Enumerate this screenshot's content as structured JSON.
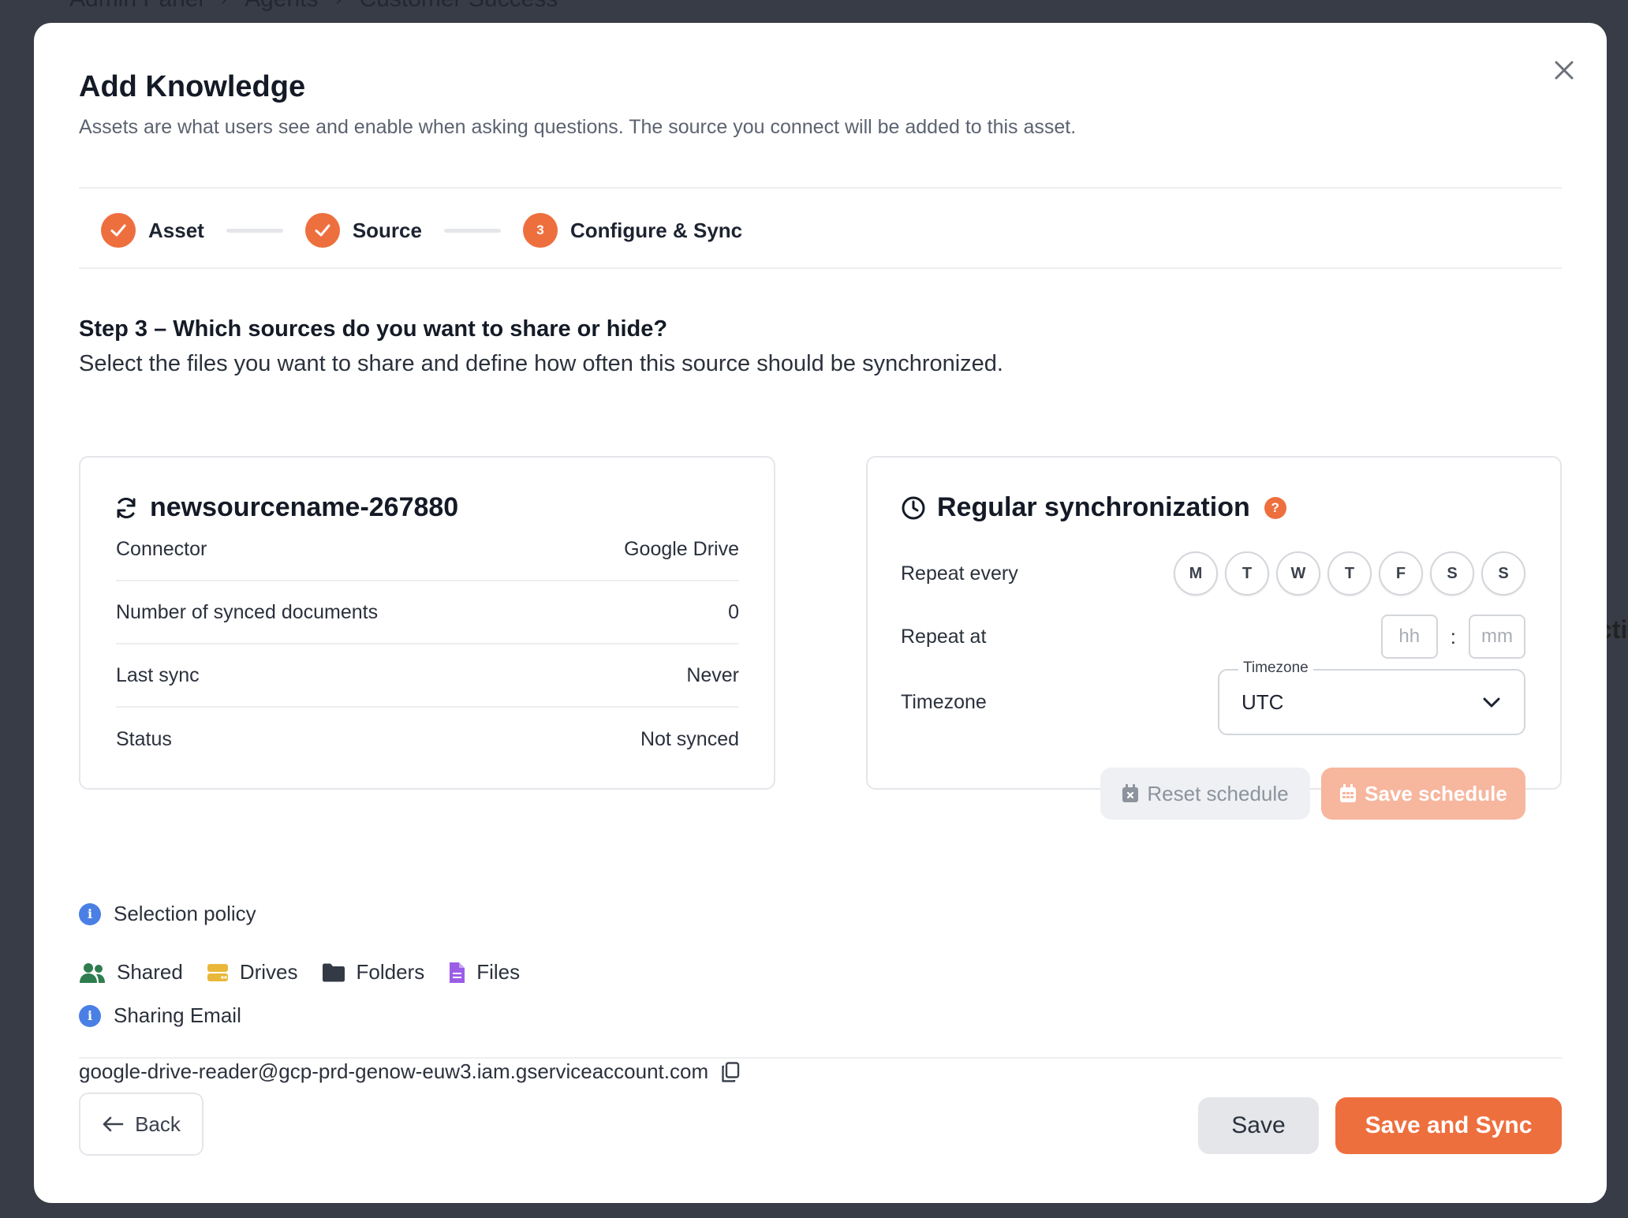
{
  "background": {
    "breadcrumb": [
      "Admin Panel",
      "Agents",
      "Customer Success"
    ],
    "edge_text": "cti"
  },
  "modal": {
    "title": "Add Knowledge",
    "subtitle": "Assets are what users see and enable when asking questions. The source you connect will be added to this asset.",
    "steps": [
      {
        "label": "Asset",
        "state": "done"
      },
      {
        "label": "Source",
        "state": "done"
      },
      {
        "label": "Configure & Sync",
        "state": "current",
        "number": "3"
      }
    ],
    "question_title": "Step 3 – Which sources do you want to share or hide?",
    "question_subtitle": "Select the files you want to share and define how often this source should be synchronized."
  },
  "source_card": {
    "name": "newsourcename-267880",
    "rows": [
      {
        "key": "Connector",
        "value": "Google Drive"
      },
      {
        "key": "Number of synced documents",
        "value": "0"
      },
      {
        "key": "Last sync",
        "value": "Never"
      },
      {
        "key": "Status",
        "value": "Not synced"
      }
    ]
  },
  "sync_card": {
    "title": "Regular synchronization",
    "help_icon": "?",
    "repeat_every_label": "Repeat every",
    "days": [
      "M",
      "T",
      "W",
      "T",
      "F",
      "S",
      "S"
    ],
    "repeat_at_label": "Repeat at",
    "hour_placeholder": "hh",
    "minute_placeholder": "mm",
    "colon": ":",
    "timezone_label": "Timezone",
    "timezone_legend": "Timezone",
    "timezone_value": "UTC",
    "reset_label": "Reset schedule",
    "save_schedule_label": "Save schedule"
  },
  "policy": {
    "selection_title": "Selection policy",
    "info_glyph": "i",
    "items": [
      {
        "label": "Shared",
        "icon": "users-icon",
        "color": "#2e7d4f"
      },
      {
        "label": "Drives",
        "icon": "drive-icon",
        "color": "#e9b83a"
      },
      {
        "label": "Folders",
        "icon": "folder-icon",
        "color": "#333a46"
      },
      {
        "label": "Files",
        "icon": "file-icon",
        "color": "#9b5de5"
      }
    ],
    "sharing_title": "Sharing Email",
    "email": "google-drive-reader@gcp-prd-genow-euw3.iam.gserviceaccount.com"
  },
  "footer": {
    "back_label": "Back",
    "save_label": "Save",
    "save_sync_label": "Save and Sync"
  },
  "colors": {
    "accent": "#ee6f3e",
    "accent_disabled": "#f7b69e",
    "info": "#4a7fe5",
    "overlay": "#373c46"
  }
}
